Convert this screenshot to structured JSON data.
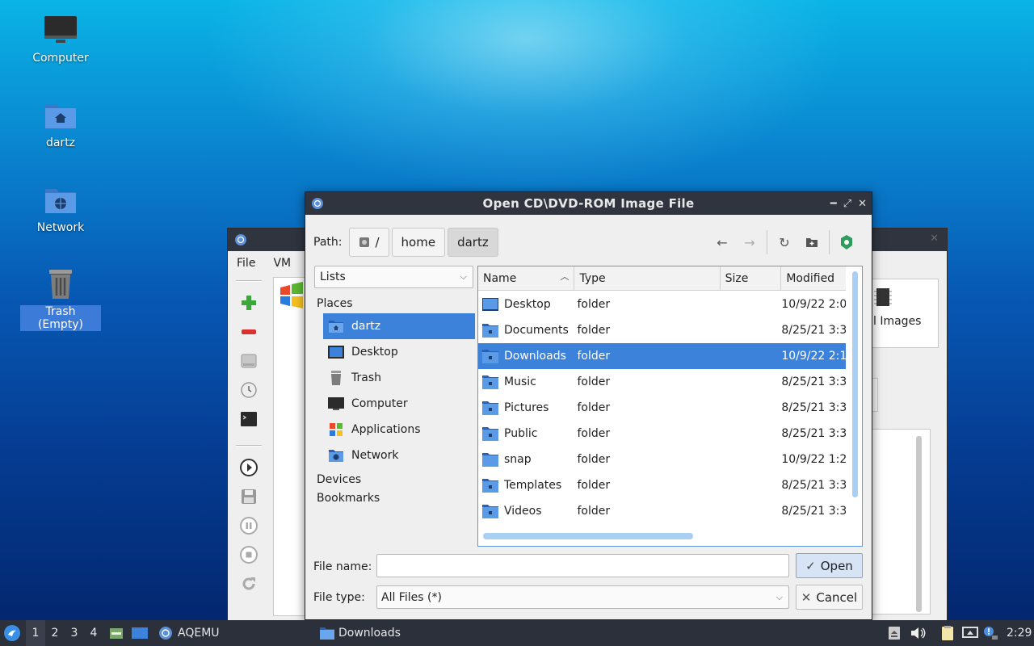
{
  "desktop": {
    "icons": [
      {
        "label": "Computer"
      },
      {
        "label": "dartz"
      },
      {
        "label": "Network"
      },
      {
        "label": "Trash (Empty)"
      }
    ]
  },
  "bg_window": {
    "menu": [
      "File",
      "VM"
    ],
    "images_text": "l Images"
  },
  "dialog": {
    "title": "Open CD\\DVD-ROM Image File",
    "path_label": "Path:",
    "crumbs": [
      "/",
      "home",
      "dartz"
    ],
    "lists_combo": "Lists",
    "sections": {
      "places": "Places",
      "devices": "Devices",
      "bookmarks": "Bookmarks"
    },
    "places": [
      {
        "label": "dartz",
        "icon": "home-folder-icon"
      },
      {
        "label": "Desktop",
        "icon": "desktop-icon"
      },
      {
        "label": "Trash",
        "icon": "trash-icon"
      },
      {
        "label": "Computer",
        "icon": "computer-icon"
      },
      {
        "label": "Applications",
        "icon": "applications-icon"
      },
      {
        "label": "Network",
        "icon": "network-icon"
      }
    ],
    "columns": {
      "name": "Name",
      "type": "Type",
      "size": "Size",
      "modified": "Modified"
    },
    "files": [
      {
        "name": "Desktop",
        "type": "folder",
        "size": "",
        "modified": "10/9/22 2:0"
      },
      {
        "name": "Documents",
        "type": "folder",
        "size": "",
        "modified": "8/25/21 3:3"
      },
      {
        "name": "Downloads",
        "type": "folder",
        "size": "",
        "modified": "10/9/22 2:1"
      },
      {
        "name": "Music",
        "type": "folder",
        "size": "",
        "modified": "8/25/21 3:3"
      },
      {
        "name": "Pictures",
        "type": "folder",
        "size": "",
        "modified": "8/25/21 3:3"
      },
      {
        "name": "Public",
        "type": "folder",
        "size": "",
        "modified": "8/25/21 3:3"
      },
      {
        "name": "snap",
        "type": "folder",
        "size": "",
        "modified": "10/9/22 1:2"
      },
      {
        "name": "Templates",
        "type": "folder",
        "size": "",
        "modified": "8/25/21 3:3"
      },
      {
        "name": "Videos",
        "type": "folder",
        "size": "",
        "modified": "8/25/21 3:3"
      }
    ],
    "selected_file": "Downloads",
    "file_name_label": "File name:",
    "file_name_value": "",
    "file_type_label": "File type:",
    "file_type_value": "All Files (*)",
    "open_label": "Open",
    "cancel_label": "Cancel"
  },
  "taskbar": {
    "workspaces": [
      "1",
      "2",
      "3",
      "4"
    ],
    "active_workspace": "1",
    "tasks": [
      {
        "label": "AQEMU"
      },
      {
        "label": "Downloads"
      }
    ],
    "clock": "2:29"
  },
  "colors": {
    "titlebar": "#2f343f",
    "selection": "#3d82da",
    "taskbar": "#2b303b",
    "folder": "#4a8fe0"
  }
}
